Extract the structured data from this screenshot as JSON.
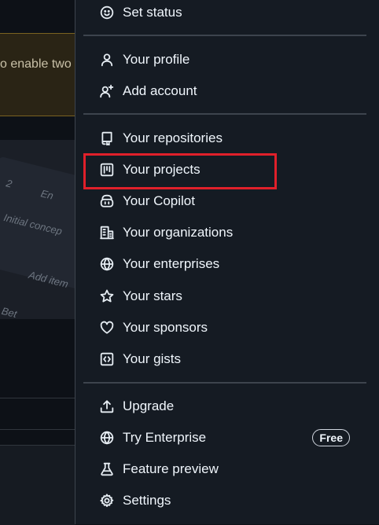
{
  "background": {
    "banner_text": "o enable two",
    "board_labels": [
      "2",
      "En",
      "Initial concep",
      "Add item",
      "Bet"
    ]
  },
  "menu": {
    "items": [
      {
        "label": "Set status",
        "icon": "smiley-icon"
      },
      {
        "label": "Your profile",
        "icon": "person-icon"
      },
      {
        "label": "Add account",
        "icon": "person-add-icon"
      },
      {
        "label": "Your repositories",
        "icon": "repo-icon"
      },
      {
        "label": "Your projects",
        "icon": "project-icon"
      },
      {
        "label": "Your Copilot",
        "icon": "copilot-icon"
      },
      {
        "label": "Your organizations",
        "icon": "organization-icon"
      },
      {
        "label": "Your enterprises",
        "icon": "globe-icon"
      },
      {
        "label": "Your stars",
        "icon": "star-icon"
      },
      {
        "label": "Your sponsors",
        "icon": "heart-icon"
      },
      {
        "label": "Your gists",
        "icon": "code-square-icon"
      },
      {
        "label": "Upgrade",
        "icon": "upload-icon"
      },
      {
        "label": "Try Enterprise",
        "icon": "globe-icon",
        "badge": "Free"
      },
      {
        "label": "Feature preview",
        "icon": "beaker-icon"
      },
      {
        "label": "Settings",
        "icon": "gear-icon"
      }
    ]
  },
  "colors": {
    "highlight_border": "#e0202a",
    "panel_bg": "#151b23"
  }
}
